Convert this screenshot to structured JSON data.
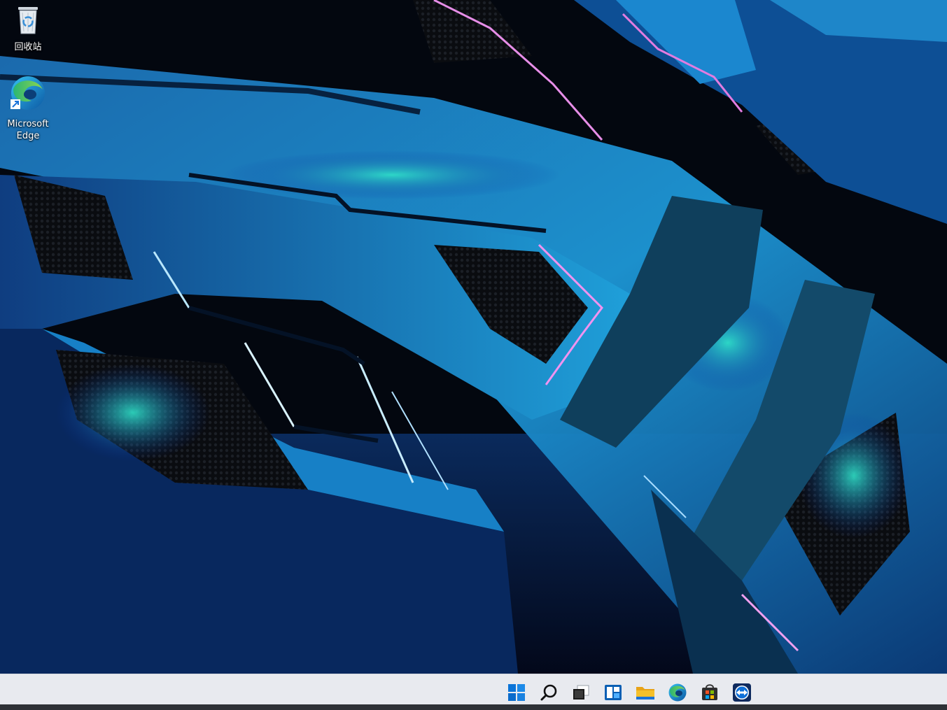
{
  "desktop": {
    "icons": [
      {
        "label": "回收站",
        "icon": "recycle-bin-icon"
      },
      {
        "label": "Microsoft\nEdge",
        "icon": "edge-icon"
      }
    ],
    "wallpaper": "abstract-blue-geometric-wallpaper"
  },
  "taskbar": {
    "apps": [
      {
        "name": "Start",
        "icon": "windows-start-icon"
      },
      {
        "name": "Search",
        "icon": "search-icon"
      },
      {
        "name": "Task View",
        "icon": "task-view-icon"
      },
      {
        "name": "Widgets",
        "icon": "widgets-icon"
      },
      {
        "name": "File Explorer",
        "icon": "folder-icon"
      },
      {
        "name": "Microsoft Edge",
        "icon": "edge-icon"
      },
      {
        "name": "Microsoft Store",
        "icon": "store-icon"
      },
      {
        "name": "TeamViewer",
        "icon": "teamviewer-icon"
      }
    ],
    "colors": {
      "background": "#e8eaef",
      "start_blue": "#0a74d8",
      "folder_yellow": "#f5c02b"
    }
  }
}
